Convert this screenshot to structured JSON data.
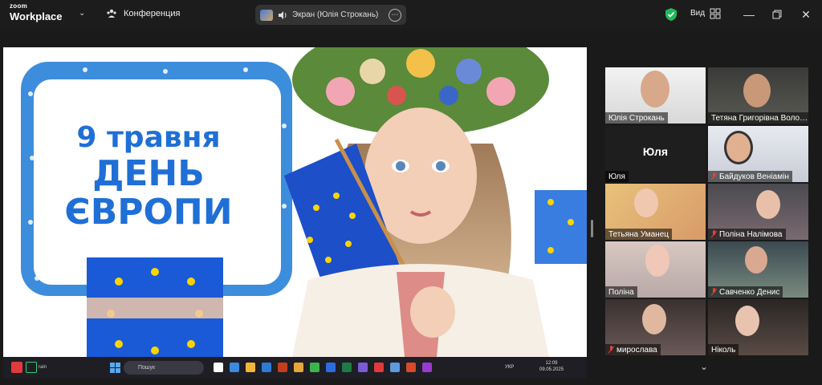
{
  "topbar": {
    "logo_line1": "zoom",
    "logo_line2": "Workplace",
    "meeting_label": "Конференция",
    "share_label": "Экран (Юлія Строкань)",
    "view_label": "Вид"
  },
  "slide": {
    "line1": "9 травня",
    "line2": "ДЕНЬ",
    "line3": "ЄВРОПИ"
  },
  "taskbar": {
    "search_placeholder": "Пошук",
    "weather": "rain",
    "lang": "УКР",
    "time": "12:09",
    "date": "09.05.2025"
  },
  "participants": [
    {
      "name": "Юлія Строкань",
      "muted": false
    },
    {
      "name": "Тетяна Григорівна Воло…",
      "muted": false
    },
    {
      "name": "Юля",
      "muted": false,
      "avatar_text": "Юля"
    },
    {
      "name": "Байдуков Веніамін",
      "muted": true
    },
    {
      "name": "Тетьяна Уманец",
      "muted": false
    },
    {
      "name": "Поліна Налімова",
      "muted": true
    },
    {
      "name": "Поліна",
      "muted": false
    },
    {
      "name": "Савченко Денис",
      "muted": true
    },
    {
      "name": "мирослава",
      "muted": true
    },
    {
      "name": "Ніколь",
      "muted": false
    }
  ],
  "colors": {
    "active_speaker": "#2fd07a",
    "slide_blue": "#1f6fd6",
    "muted_red": "#e0433b"
  }
}
